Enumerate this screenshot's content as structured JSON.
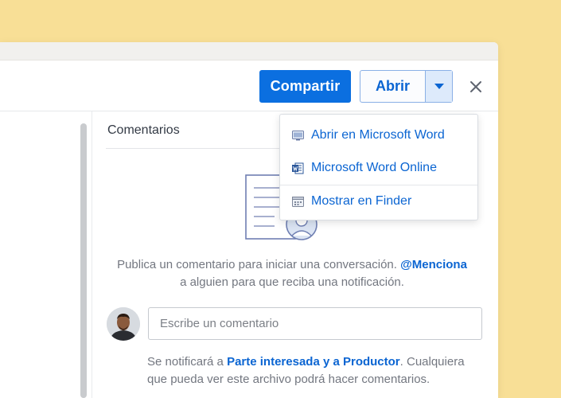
{
  "toolbar": {
    "share_label": "Compartir",
    "open_label": "Abrir"
  },
  "open_menu": {
    "items": [
      {
        "label": "Abrir en Microsoft Word",
        "icon": "desktop-app-icon"
      },
      {
        "label": "Microsoft Word Online",
        "icon": "word-icon"
      },
      {
        "label": "Mostrar en Finder",
        "icon": "finder-icon"
      }
    ]
  },
  "comments": {
    "title": "Comentarios",
    "empty_text_1": "Publica un comentario para iniciar una conversación.",
    "empty_mention": "@Menciona",
    "empty_text_2": "a alguien para que reciba una notificación.",
    "input_placeholder": "Escribe un comentario",
    "notify_prefix": "Se notificará a",
    "notify_people": "Parte interesada y a Productor",
    "notify_suffix": ". Cualquiera que pueda ver este archivo podrá hacer comentarios."
  },
  "colors": {
    "background": "#f8df96",
    "accent": "#0b6fe0",
    "link": "#0b65d2"
  }
}
